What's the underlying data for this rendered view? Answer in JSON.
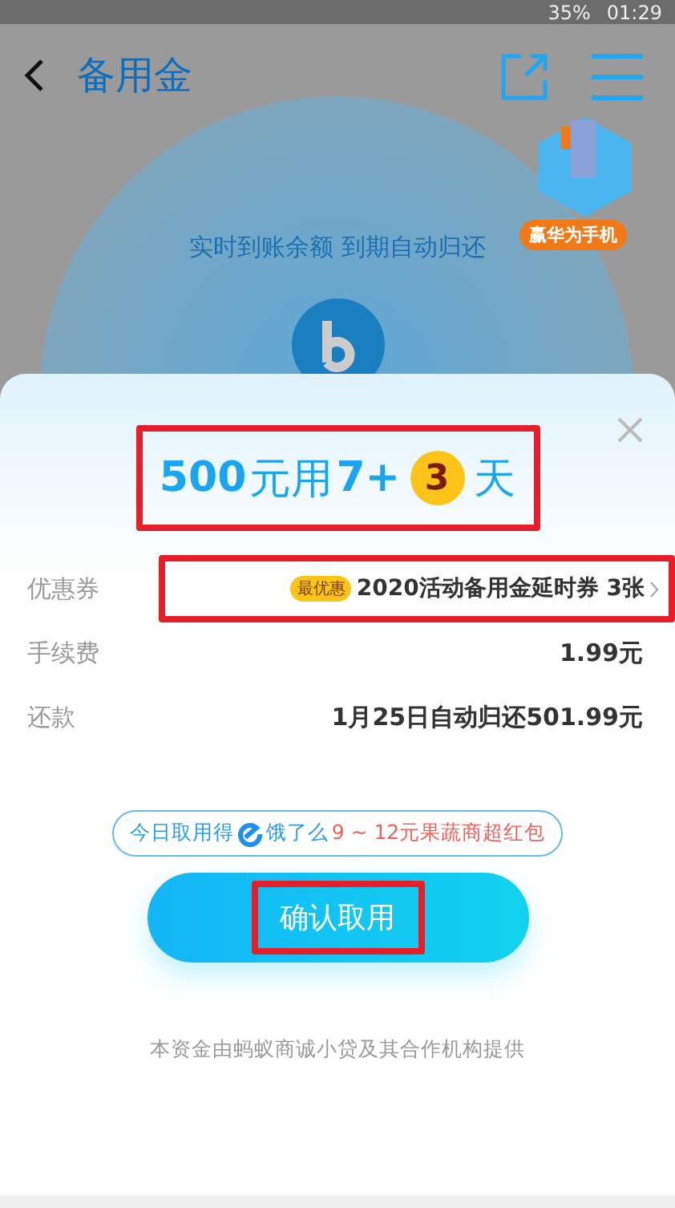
{
  "status_bar": {
    "battery": "35%",
    "time": "01:29"
  },
  "header": {
    "title": "备用金",
    "badge": "赢华为手机"
  },
  "hero": {
    "subtitle": "实时到账余额 到期自动归还"
  },
  "sheet": {
    "title": {
      "amount": "500",
      "unit": "元用",
      "base": "7+",
      "bonus": "3",
      "suffix": "天"
    },
    "rows": [
      {
        "kind": "coupon",
        "label": "优惠券",
        "tag": "最优惠",
        "value": "2020活动备用金延时券 3张"
      },
      {
        "kind": "plain",
        "label": "手续费",
        "value": "1.99元"
      },
      {
        "kind": "plain",
        "label": "还款",
        "value": "1月25日自动归还501.99元"
      }
    ],
    "tip": {
      "lead": "今日取用得",
      "brand": "饿了么",
      "offer": "9 ~ 12元果蔬商超红包"
    },
    "button": "确认取用",
    "footer": "本资金由蚂蚁商诚小贷及其合作机构提供"
  }
}
